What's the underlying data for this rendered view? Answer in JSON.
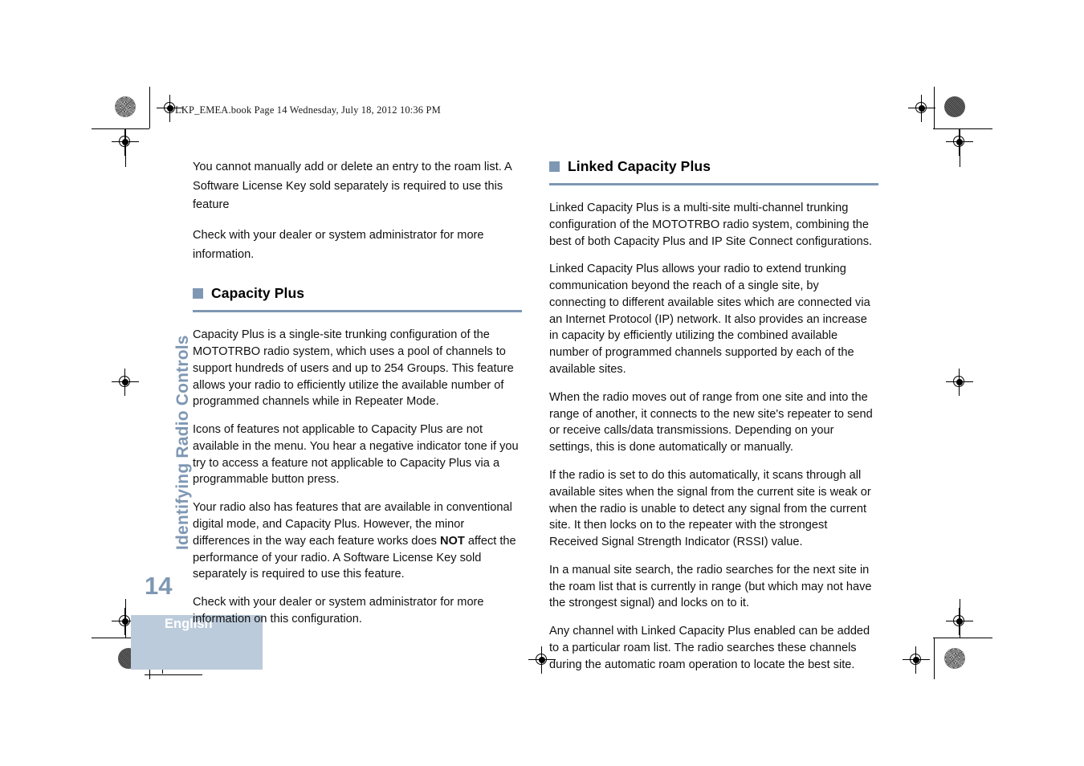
{
  "document": {
    "running_header": "LKP_EMEA.book  Page 14  Wednesday, July 18, 2012  10:36 PM",
    "side_tab": "Identifying Radio Controls",
    "folio": "14",
    "language": "English",
    "accent_color": "#7e97b3",
    "language_box_color": "#bccbdb"
  },
  "left_column": {
    "intro_paragraphs": [
      "You cannot manually add or delete an entry to the roam list. A Software License Key sold separately is required to use this feature",
      "Check with your dealer or system administrator for more information."
    ],
    "section": {
      "bullet_icon": "square-bullet-icon",
      "title": "Capacity Plus",
      "paragraphs": [
        "Capacity Plus is a single-site trunking configuration of the MOTOTRBO radio system, which uses a pool of channels to support hundreds of users and up to 254 Groups. This feature allows your radio to efficiently utilize the available number of programmed channels while in Repeater Mode.",
        "Icons of features not applicable to Capacity Plus are not available in the menu. You hear a negative indicator tone if you try to access a feature not applicable to Capacity Plus via a programmable button press.",
        "Check with your dealer or system administrator for more information on this configuration."
      ],
      "emphasis_paragraph": {
        "before": "Your radio also has features that are available in conventional digital mode, and Capacity Plus. However, the minor differences in the way each feature works does ",
        "bold": "NOT",
        "after": " affect the performance of your radio. A Software License Key sold separately is required to use this feature."
      }
    }
  },
  "right_column": {
    "section": {
      "bullet_icon": "square-bullet-icon",
      "title": "Linked Capacity Plus",
      "paragraphs": [
        "Linked Capacity Plus is a multi-site multi-channel trunking configuration of the MOTOTRBO radio system, combining the best of both Capacity Plus and IP Site Connect configurations.",
        "Linked Capacity Plus allows your radio to extend trunking communication beyond the reach of a single site, by connecting to different available sites which are connected via an Internet Protocol (IP) network. It also provides an increase in capacity by efficiently utilizing the combined available number of programmed channels supported by each of the available sites.",
        "When the radio moves out of range from one site and into the range of another, it connects to the new site's repeater to send or receive calls/data transmissions. Depending on your settings, this is done automatically or manually.",
        "If the radio is set to do this automatically, it scans through all available sites when the signal from the current site is weak or when the radio is unable to detect any signal from the current site. It then locks on to the repeater with the strongest Received Signal Strength Indicator (RSSI) value.",
        "In a manual site search, the radio searches for the next site in the roam list that is currently in range (but which may not have the strongest signal) and locks on to it.",
        "Any channel with Linked Capacity Plus enabled can be added to a particular roam list. The radio searches these channels during the automatic roam operation to locate the best site."
      ]
    }
  }
}
